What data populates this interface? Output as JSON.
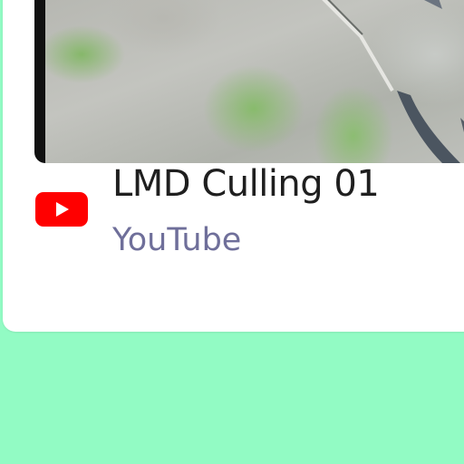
{
  "card": {
    "title": "LMD Culling 01",
    "source": "YouTube",
    "source_icon": "youtube-icon"
  },
  "colors": {
    "background": "#92fbc4",
    "card": "#ffffff",
    "youtube_red": "#ff0000",
    "title": "#1f1f1f",
    "source": "#6f6f9a"
  }
}
